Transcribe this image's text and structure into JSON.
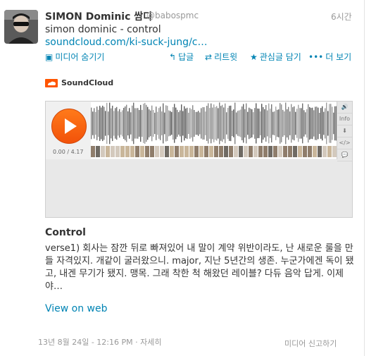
{
  "tweet": {
    "name": "SIMON Dominic 쌈디",
    "handle": "@babospmc",
    "time": "6시간",
    "text": "simon dominic - control",
    "link": "soundcloud.com/ki-suck-jung/c…"
  },
  "actions": {
    "hide_media": "미디어 숨기기",
    "reply": "답글",
    "retweet": "리트윗",
    "favorite": "관심글 담기",
    "more": "더 보기"
  },
  "card": {
    "provider": "SoundCloud",
    "duration": "0.00 / 4.17",
    "side_buttons": [
      "🔊",
      "Info",
      "⬇",
      "</>",
      "💬"
    ],
    "title": "Control",
    "body": "verse1) 회사는 잠깐 뒤로 빠져있어 내 말이 계약 위반이라도, 난 새로운 룰을 만들 자격있지. 개같이 굴러왔으니. major, 지난 5년간의 생존. 누군가에겐 독이 됐고, 내겐 무기가 됐지. 맹목. 그래 착한 척 해왔던 레이블? 다듀 음악 답게. 이제야…",
    "view_on_web": "View on web"
  },
  "footer": {
    "timestamp": "13년 8월 24일 - 12:16 PM",
    "details": "자세히",
    "report": "미디어 신고하기"
  },
  "colors": {
    "link": "#0084b4",
    "soundcloud_orange": "#ff5500"
  }
}
